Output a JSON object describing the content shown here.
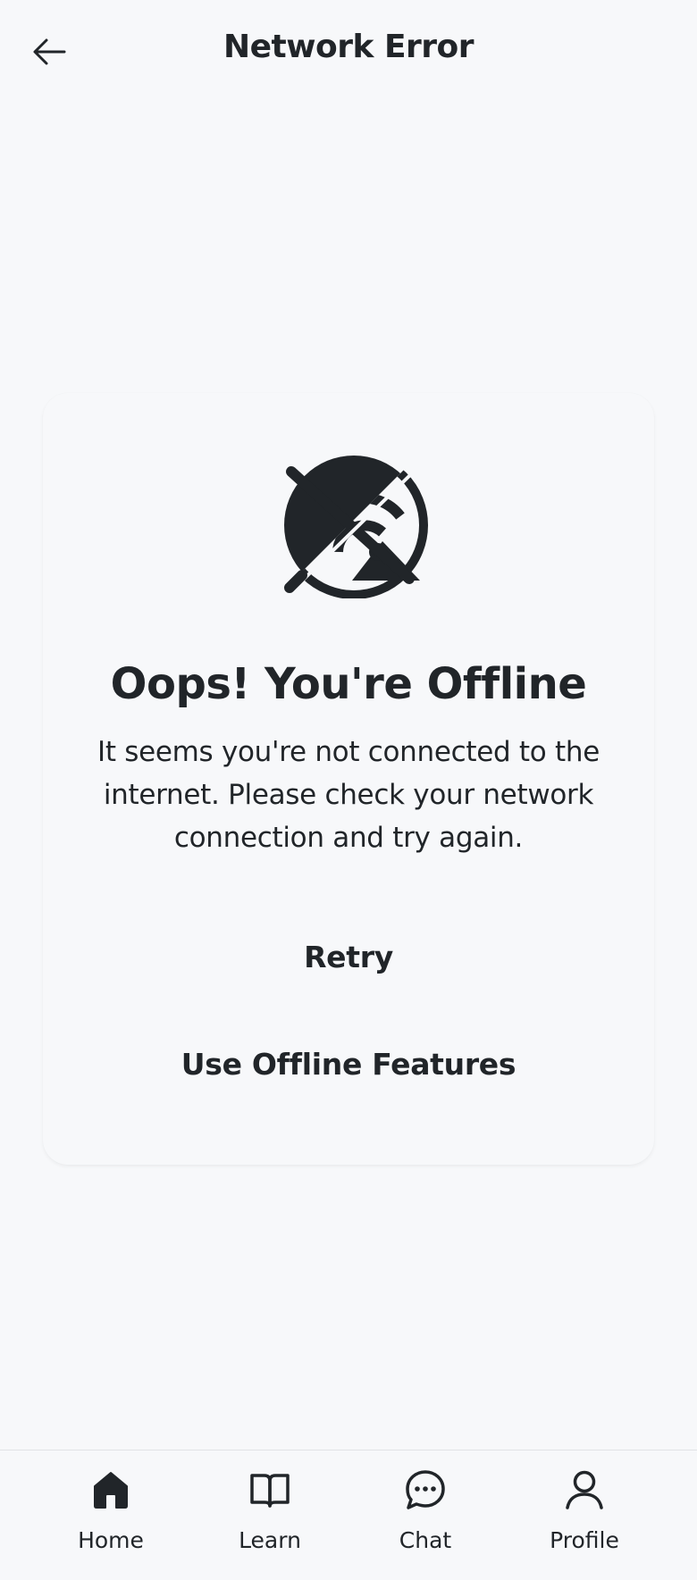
{
  "header": {
    "title": "Network Error",
    "back_icon": "arrow-left-icon"
  },
  "card": {
    "icon": "wifi-off-icon",
    "title": "Oops! You're Offline",
    "message": "It seems you're not connected to the internet. Please check your network connection and try again.",
    "retry_label": "Retry",
    "offline_label": "Use Offline Features"
  },
  "bottom_nav": {
    "items": [
      {
        "label": "Home",
        "icon": "home-icon",
        "active": true
      },
      {
        "label": "Learn",
        "icon": "book-open-icon",
        "active": false
      },
      {
        "label": "Chat",
        "icon": "chat-bubble-icon",
        "active": false
      },
      {
        "label": "Profile",
        "icon": "user-icon",
        "active": false
      }
    ]
  },
  "colors": {
    "background": "#f7f8fa",
    "text": "#212529",
    "divider": "#e1e3e6"
  }
}
